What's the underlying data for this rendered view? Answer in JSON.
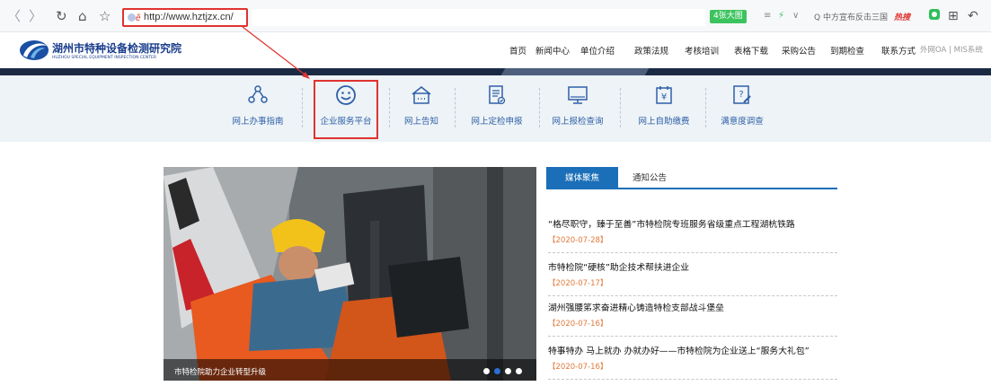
{
  "browser": {
    "back": "〈",
    "forward": "〉",
    "reload": "↻",
    "home": "⌂",
    "star": "☆",
    "url": "http://www.hztjzx.cn/",
    "security_glyph": "ẽ",
    "ext_badge": "4张大图",
    "hot_search": "Q 中方宣布反击三国",
    "hot_tag": "热搜",
    "apps_icon": "⊞",
    "undo_icon": "↶"
  },
  "site": {
    "name": "湖州市特种设备检测研究院",
    "subtitle": "HUZHOU SPECIAL EQUIPMENT INSPECTION CENTER",
    "nav": [
      "首页",
      "新闻中心",
      "单位介绍",
      "政策法规",
      "考核培训",
      "表格下载",
      "采购公告",
      "到期检查",
      "联系方式"
    ],
    "nav_extra": "外网OA | MIS系统"
  },
  "services": [
    {
      "label": "网上办事指南",
      "icon": "people-network-icon"
    },
    {
      "label": "企业服务平台",
      "icon": "smiley-icon"
    },
    {
      "label": "网上告知",
      "icon": "house-notice-icon"
    },
    {
      "label": "网上定检申报",
      "icon": "document-check-icon"
    },
    {
      "label": "网上报检查询",
      "icon": "monitor-icon"
    },
    {
      "label": "网上自助缴费",
      "icon": "yuan-payment-icon"
    },
    {
      "label": "满意度调查",
      "icon": "survey-icon"
    }
  ],
  "carousel": {
    "caption": "市特检院助力企业转型升级",
    "slide_count": 4,
    "active_index": 1
  },
  "news": {
    "tabs": [
      "媒体聚焦",
      "通知公告"
    ],
    "items": [
      {
        "title": "“格尽职守，臻于至善”市特检院专班服务省级重点工程湖杭铁路",
        "date": "【2020-07-28】"
      },
      {
        "title": "市特检院“硬核”助企技术帮扶进企业",
        "date": "【2020-07-17】"
      },
      {
        "title": "湖州强腰笫求奋进精心铸造特检支部战斗堡垒",
        "date": "【2020-07-16】"
      },
      {
        "title": "特事特办 马上就办 办就办好——市特检院为企业送上“服务大礼包”",
        "date": "【2020-07-16】"
      }
    ]
  },
  "colors": {
    "accent_red": "#e0322f",
    "brand_blue": "#1b6fb8",
    "service_bg": "#edf3f6",
    "date_orange": "#e07a3c"
  }
}
